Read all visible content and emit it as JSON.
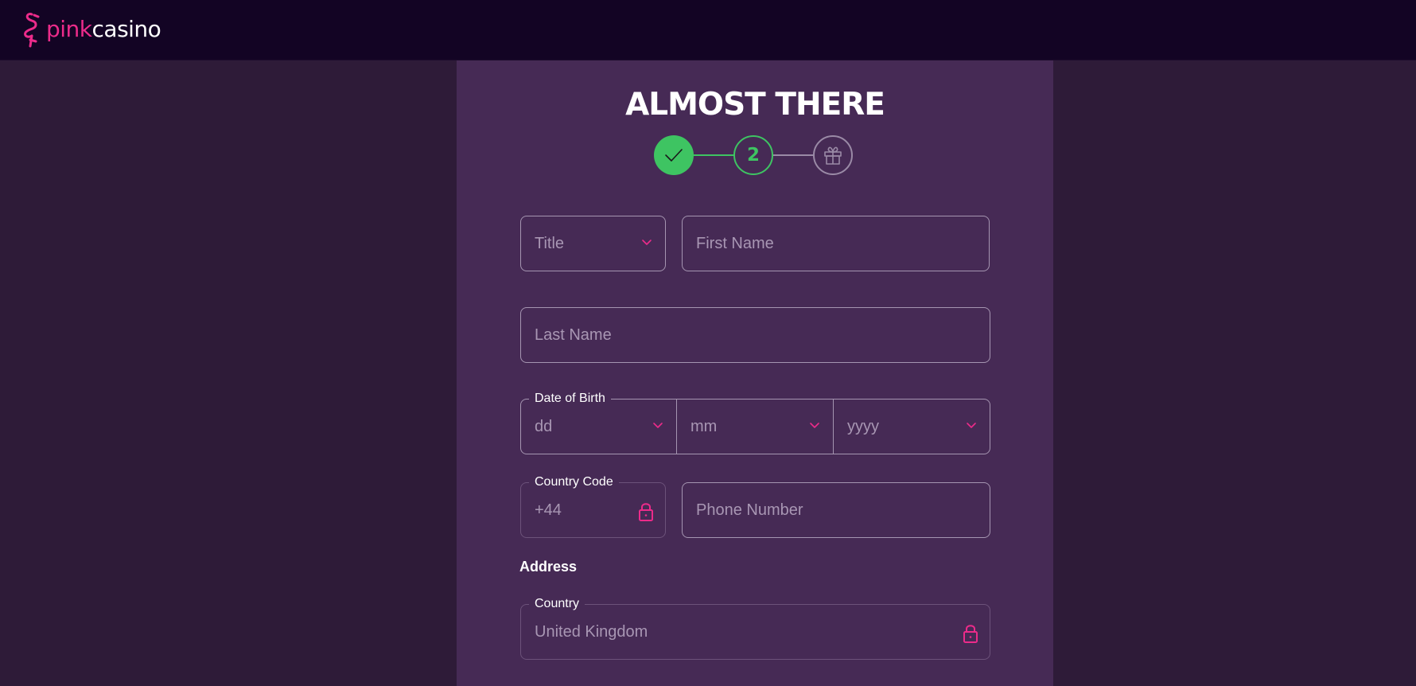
{
  "brand": {
    "name_part1": "pink",
    "name_part2": "casino",
    "accent": "#ec2b8a"
  },
  "page": {
    "heading": "ALMOST THERE"
  },
  "stepper": {
    "steps": [
      {
        "state": "done",
        "icon": "check-icon"
      },
      {
        "state": "current",
        "label": "2"
      },
      {
        "state": "upcoming",
        "icon": "gift-icon"
      }
    ],
    "done_color": "#3ec462",
    "upcoming_color": "#9a8aa6"
  },
  "form": {
    "title": {
      "placeholder": "Title",
      "icon": "chevron-down-icon"
    },
    "first_name": {
      "placeholder": "First Name"
    },
    "last_name": {
      "placeholder": "Last Name"
    },
    "dob": {
      "legend": "Date of Birth",
      "day": "dd",
      "month": "mm",
      "year": "yyyy"
    },
    "country_code": {
      "legend": "Country Code",
      "value": "+44",
      "icon": "lock-icon"
    },
    "phone": {
      "placeholder": "Phone Number"
    },
    "address_heading": "Address",
    "country": {
      "legend": "Country",
      "value": "United Kingdom",
      "icon": "lock-icon"
    }
  },
  "colors": {
    "page_bg": "#2e1b38",
    "topbar_bg": "#130424",
    "panel_bg": "#462a55",
    "field_border": "#a595b1",
    "placeholder": "#a896b3"
  }
}
